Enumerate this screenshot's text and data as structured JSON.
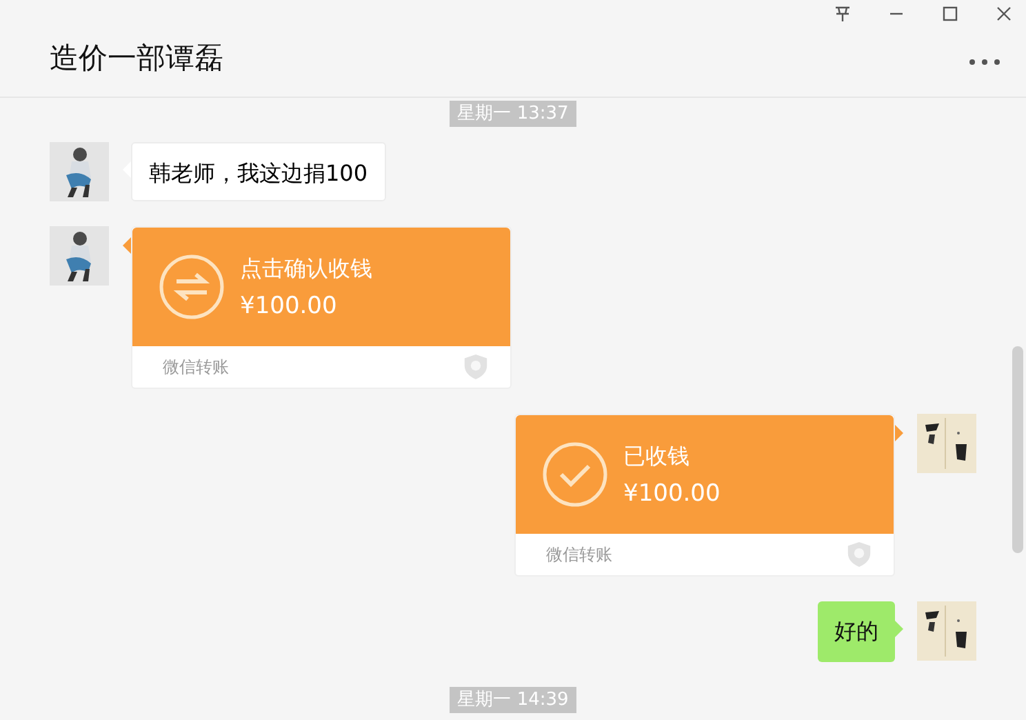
{
  "window": {
    "title": "造价一部谭磊"
  },
  "messages": [
    {
      "kind": "time",
      "text": "星期一 13:37"
    },
    {
      "kind": "text",
      "outgoing": false,
      "text": "韩老师，我这边捐100"
    },
    {
      "kind": "transfer",
      "outgoing": false,
      "received": false,
      "title": "点击确认收钱",
      "amount": "¥100.00",
      "footer": "微信转账"
    },
    {
      "kind": "transfer",
      "outgoing": true,
      "received": true,
      "title": "已收钱",
      "amount": "¥100.00",
      "footer": "微信转账"
    },
    {
      "kind": "text",
      "outgoing": true,
      "text": "好的"
    },
    {
      "kind": "time",
      "text": "星期一 14:39"
    }
  ]
}
